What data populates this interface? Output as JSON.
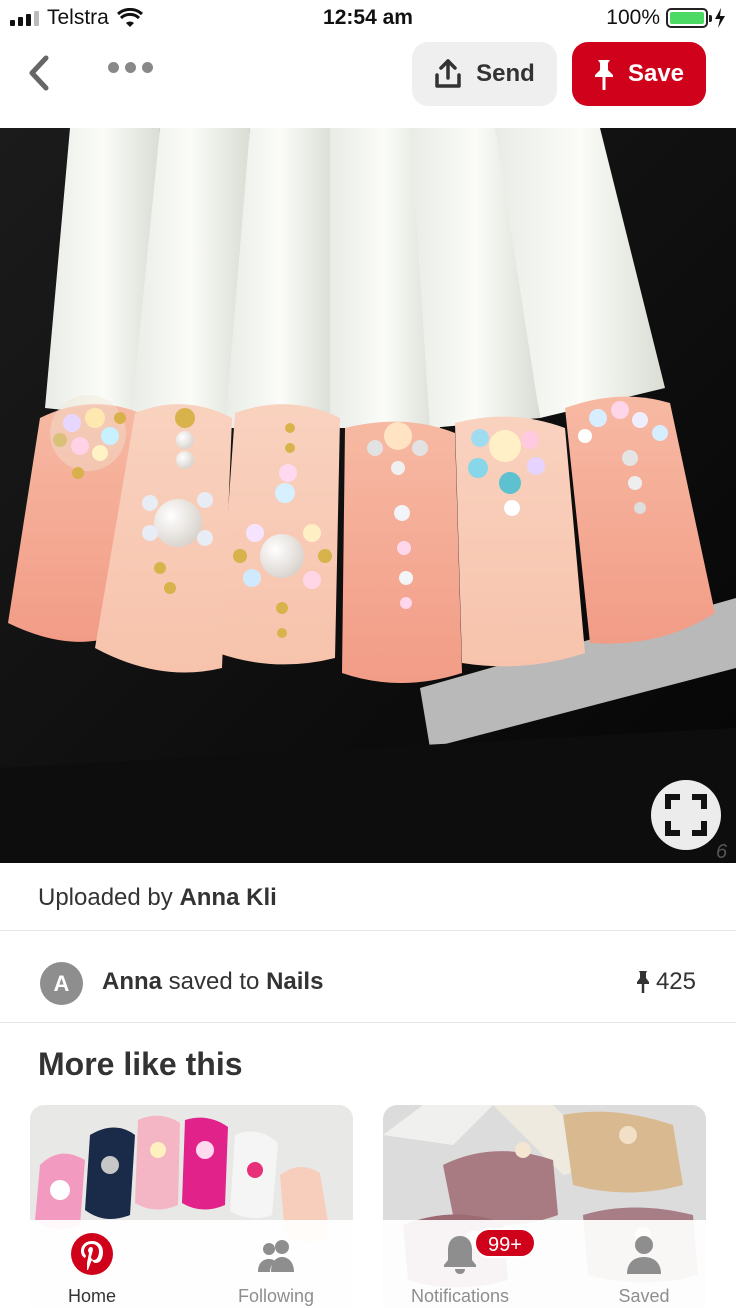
{
  "status_bar": {
    "carrier": "Telstra",
    "time": "12:54 am",
    "battery": "100%"
  },
  "toolbar": {
    "send_label": "Send",
    "save_label": "Save"
  },
  "pin": {
    "uploaded_prefix": "Uploaded by",
    "uploader": "Anna Kli",
    "saver_initial": "A",
    "saver": "Anna",
    "saved_to_text": "saved to",
    "board": "Nails",
    "save_count": "425"
  },
  "more_like_this": {
    "title": "More like this"
  },
  "bottom_nav": {
    "items": [
      {
        "label": "Home",
        "icon": "pinterest-logo-icon"
      },
      {
        "label": "Following",
        "icon": "people-icon"
      },
      {
        "label": "Notifications",
        "icon": "bell-icon"
      },
      {
        "label": "Saved",
        "icon": "person-icon"
      }
    ],
    "notifications_badge": "99+"
  },
  "colors": {
    "brand_red": "#d0021b",
    "battery_green": "#4cd964",
    "nail_pink": "#f5a58f"
  }
}
